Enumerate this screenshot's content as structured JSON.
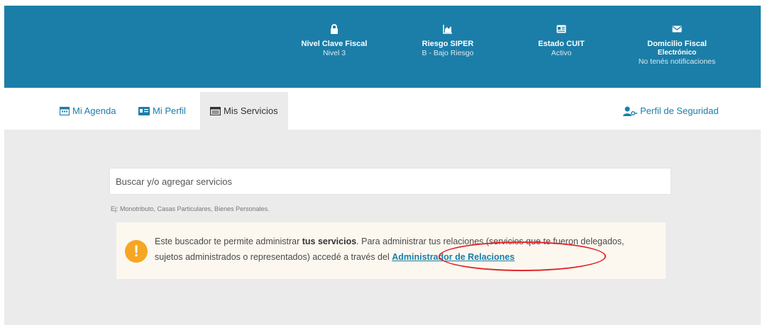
{
  "header": {
    "stats": [
      {
        "title": "Nivel Clave Fiscal",
        "value": "Nivel 3",
        "icon": "lock-icon"
      },
      {
        "title": "Riesgo SIPER",
        "value": "B - Bajo Riesgo",
        "icon": "area-chart-icon"
      },
      {
        "title": "Estado CUIT",
        "value": "Activo",
        "icon": "id-card-icon"
      },
      {
        "title": "Domicilio Fiscal",
        "title_line2": "Electrónico",
        "value": "No tenés notificaciones",
        "icon": "envelope-icon"
      }
    ]
  },
  "nav": {
    "tabs": [
      {
        "label": "Mi Agenda",
        "icon": "calendar-icon"
      },
      {
        "label": "Mi Perfil",
        "icon": "id-card-icon"
      },
      {
        "label": "Mis Servicios",
        "icon": "services-icon",
        "active": true
      }
    ],
    "security": {
      "label": "Perfil de Seguridad",
      "icon": "user-key-icon"
    }
  },
  "search": {
    "placeholder": "Buscar y/o agregar servicios",
    "hint": "Ej: Monotributo, Casas Particulares, Bienes Personales."
  },
  "notice": {
    "part1": "Este buscador te permite administrar ",
    "bold": "tus servicios",
    "part2": ". Para administrar tus relaciones (servicios que te fueron delegados, sujetos administrados o representados) accedé a través del ",
    "link": "Administrador de Relaciones"
  },
  "colors": {
    "header_bg": "#1b7ea8",
    "warning": "#f5a623",
    "annotation": "#e2262a"
  }
}
